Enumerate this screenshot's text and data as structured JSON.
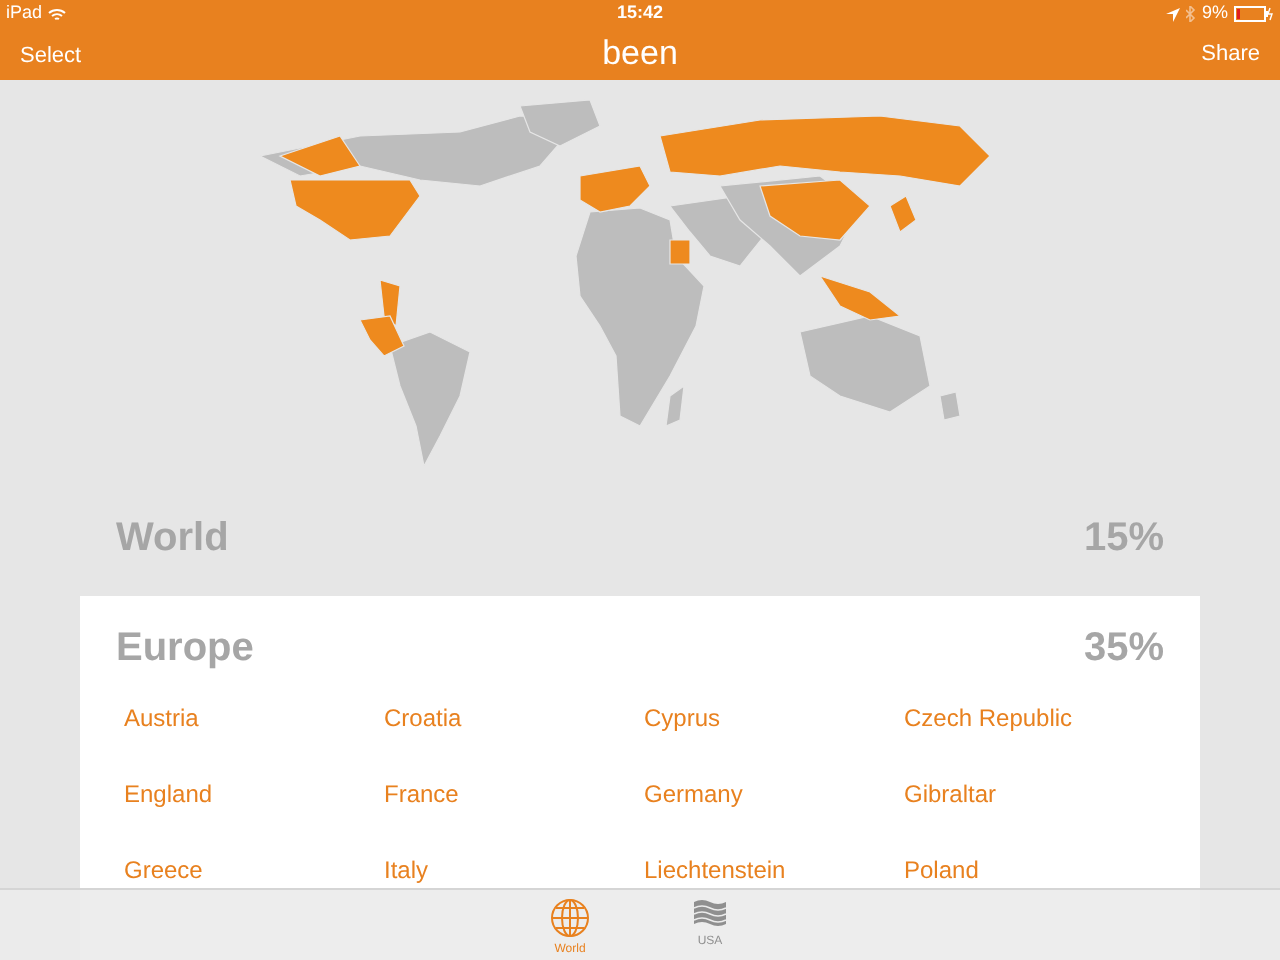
{
  "status_bar": {
    "device": "iPad",
    "time": "15:42",
    "battery": "9%"
  },
  "nav": {
    "left": "Select",
    "title": "been",
    "right": "Share"
  },
  "world": {
    "label": "World",
    "percent": "15%"
  },
  "region": {
    "label": "Europe",
    "percent": "35%",
    "countries": [
      "Austria",
      "Croatia",
      "Cyprus",
      "Czech Republic",
      "England",
      "France",
      "Germany",
      "Gibraltar",
      "Greece",
      "Italy",
      "Liechtenstein",
      "Poland"
    ]
  },
  "tabs": [
    {
      "label": "World",
      "kind": "globe",
      "selected": true
    },
    {
      "label": "USA",
      "kind": "flag",
      "selected": false
    }
  ]
}
